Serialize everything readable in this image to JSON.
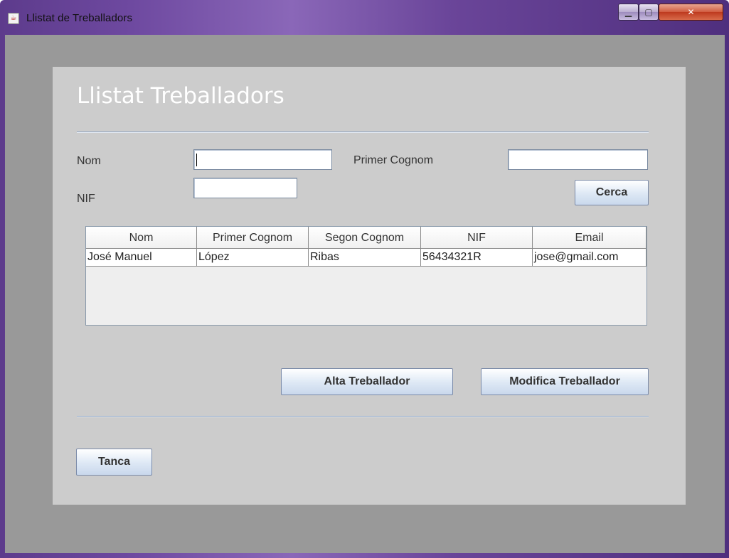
{
  "window": {
    "title": "Llistat de Treballadors"
  },
  "heading": "Llistat Treballadors",
  "form": {
    "nom_label": "Nom",
    "nom_value": "",
    "cognom_label": "Primer Cognom",
    "cognom_value": "",
    "nif_label": "NIF",
    "nif_value": "",
    "search_button": "Cerca"
  },
  "table": {
    "columns": [
      "Nom",
      "Primer Cognom",
      "Segon Cognom",
      "NIF",
      "Email"
    ],
    "rows": [
      [
        "José Manuel",
        "López",
        "Ribas",
        "56434321R",
        "jose@gmail.com"
      ]
    ]
  },
  "actions": {
    "add_button": "Alta Treballador",
    "edit_button": "Modifica Treballador",
    "close_button": "Tanca"
  }
}
